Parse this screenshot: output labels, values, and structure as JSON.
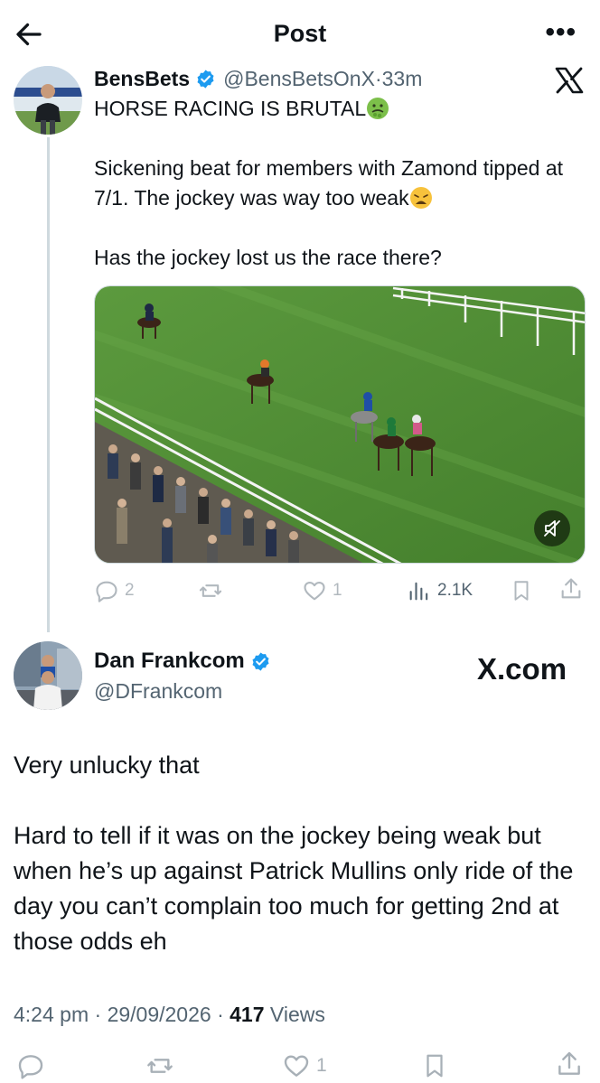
{
  "header": {
    "title": "Post",
    "back_icon": "arrow-left-icon",
    "more_icon": "more-horizontal-icon",
    "more_label": "•••"
  },
  "quoted_post": {
    "author_name": "BensBets",
    "handle": "@BensBetsOnX",
    "separator": "·",
    "time": "33m",
    "verified": true,
    "line1": "HORSE RACING IS BRUTAL",
    "line1_emoji": "nauseated-face-emoji",
    "line2": "Sickening beat for members with Zamond tipped at 7/1. The jockey was way too weak",
    "line2_emoji": "weary-face-emoji",
    "line3": "Has the jockey lost us the race there?",
    "media": {
      "type": "video",
      "description_icon": "video-thumbnail",
      "muted": true
    },
    "stats": {
      "replies": "2",
      "reposts": "",
      "likes": "1",
      "views": "2.1K"
    }
  },
  "post": {
    "author_name": "Dan Frankcom",
    "handle": "@DFrankcom",
    "verified": true,
    "watermark": "X.com",
    "paragraph1": "Very unlucky that",
    "paragraph2": "Hard to tell if it was on the jockey being weak but when he’s up against Patrick Mullins only ride of the day you can’t complain too much for getting 2nd at those odds eh",
    "time": "4:24 pm",
    "date": "29/09/2026",
    "dot": "·",
    "views_count": "417",
    "views_label": "Views",
    "stats": {
      "likes": "1"
    }
  },
  "colors": {
    "text": "#0f1419",
    "secondary": "#536471",
    "verified_blue": "#1d9bf0",
    "turf": "#4c8a35",
    "divider": "#cfd9de"
  }
}
